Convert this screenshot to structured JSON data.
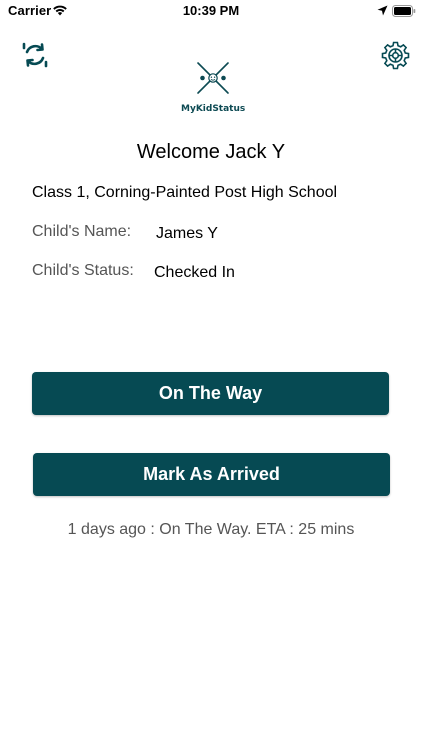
{
  "status_bar": {
    "carrier": "Carrier",
    "time": "10:39 PM"
  },
  "logo": {
    "name": "MyKidStatus"
  },
  "welcome": "Welcome Jack Y",
  "school": "Class 1, Corning-Painted Post High School",
  "child": {
    "name_label": "Child's Name:",
    "name_value": "James Y",
    "status_label": "Child's Status:",
    "status_value": "Checked In"
  },
  "buttons": {
    "on_the_way": "On The Way",
    "mark_arrived": "Mark As Arrived"
  },
  "last_update": "1 days ago : On The Way. ETA : 25 mins",
  "colors": {
    "primary": "#064a53",
    "label_gray": "#555555",
    "background": "#ffffff"
  },
  "icons": {
    "refresh": "refresh-icon",
    "settings": "gear-icon",
    "wifi": "wifi-icon",
    "location": "location-arrow-icon",
    "battery": "battery-icon"
  }
}
